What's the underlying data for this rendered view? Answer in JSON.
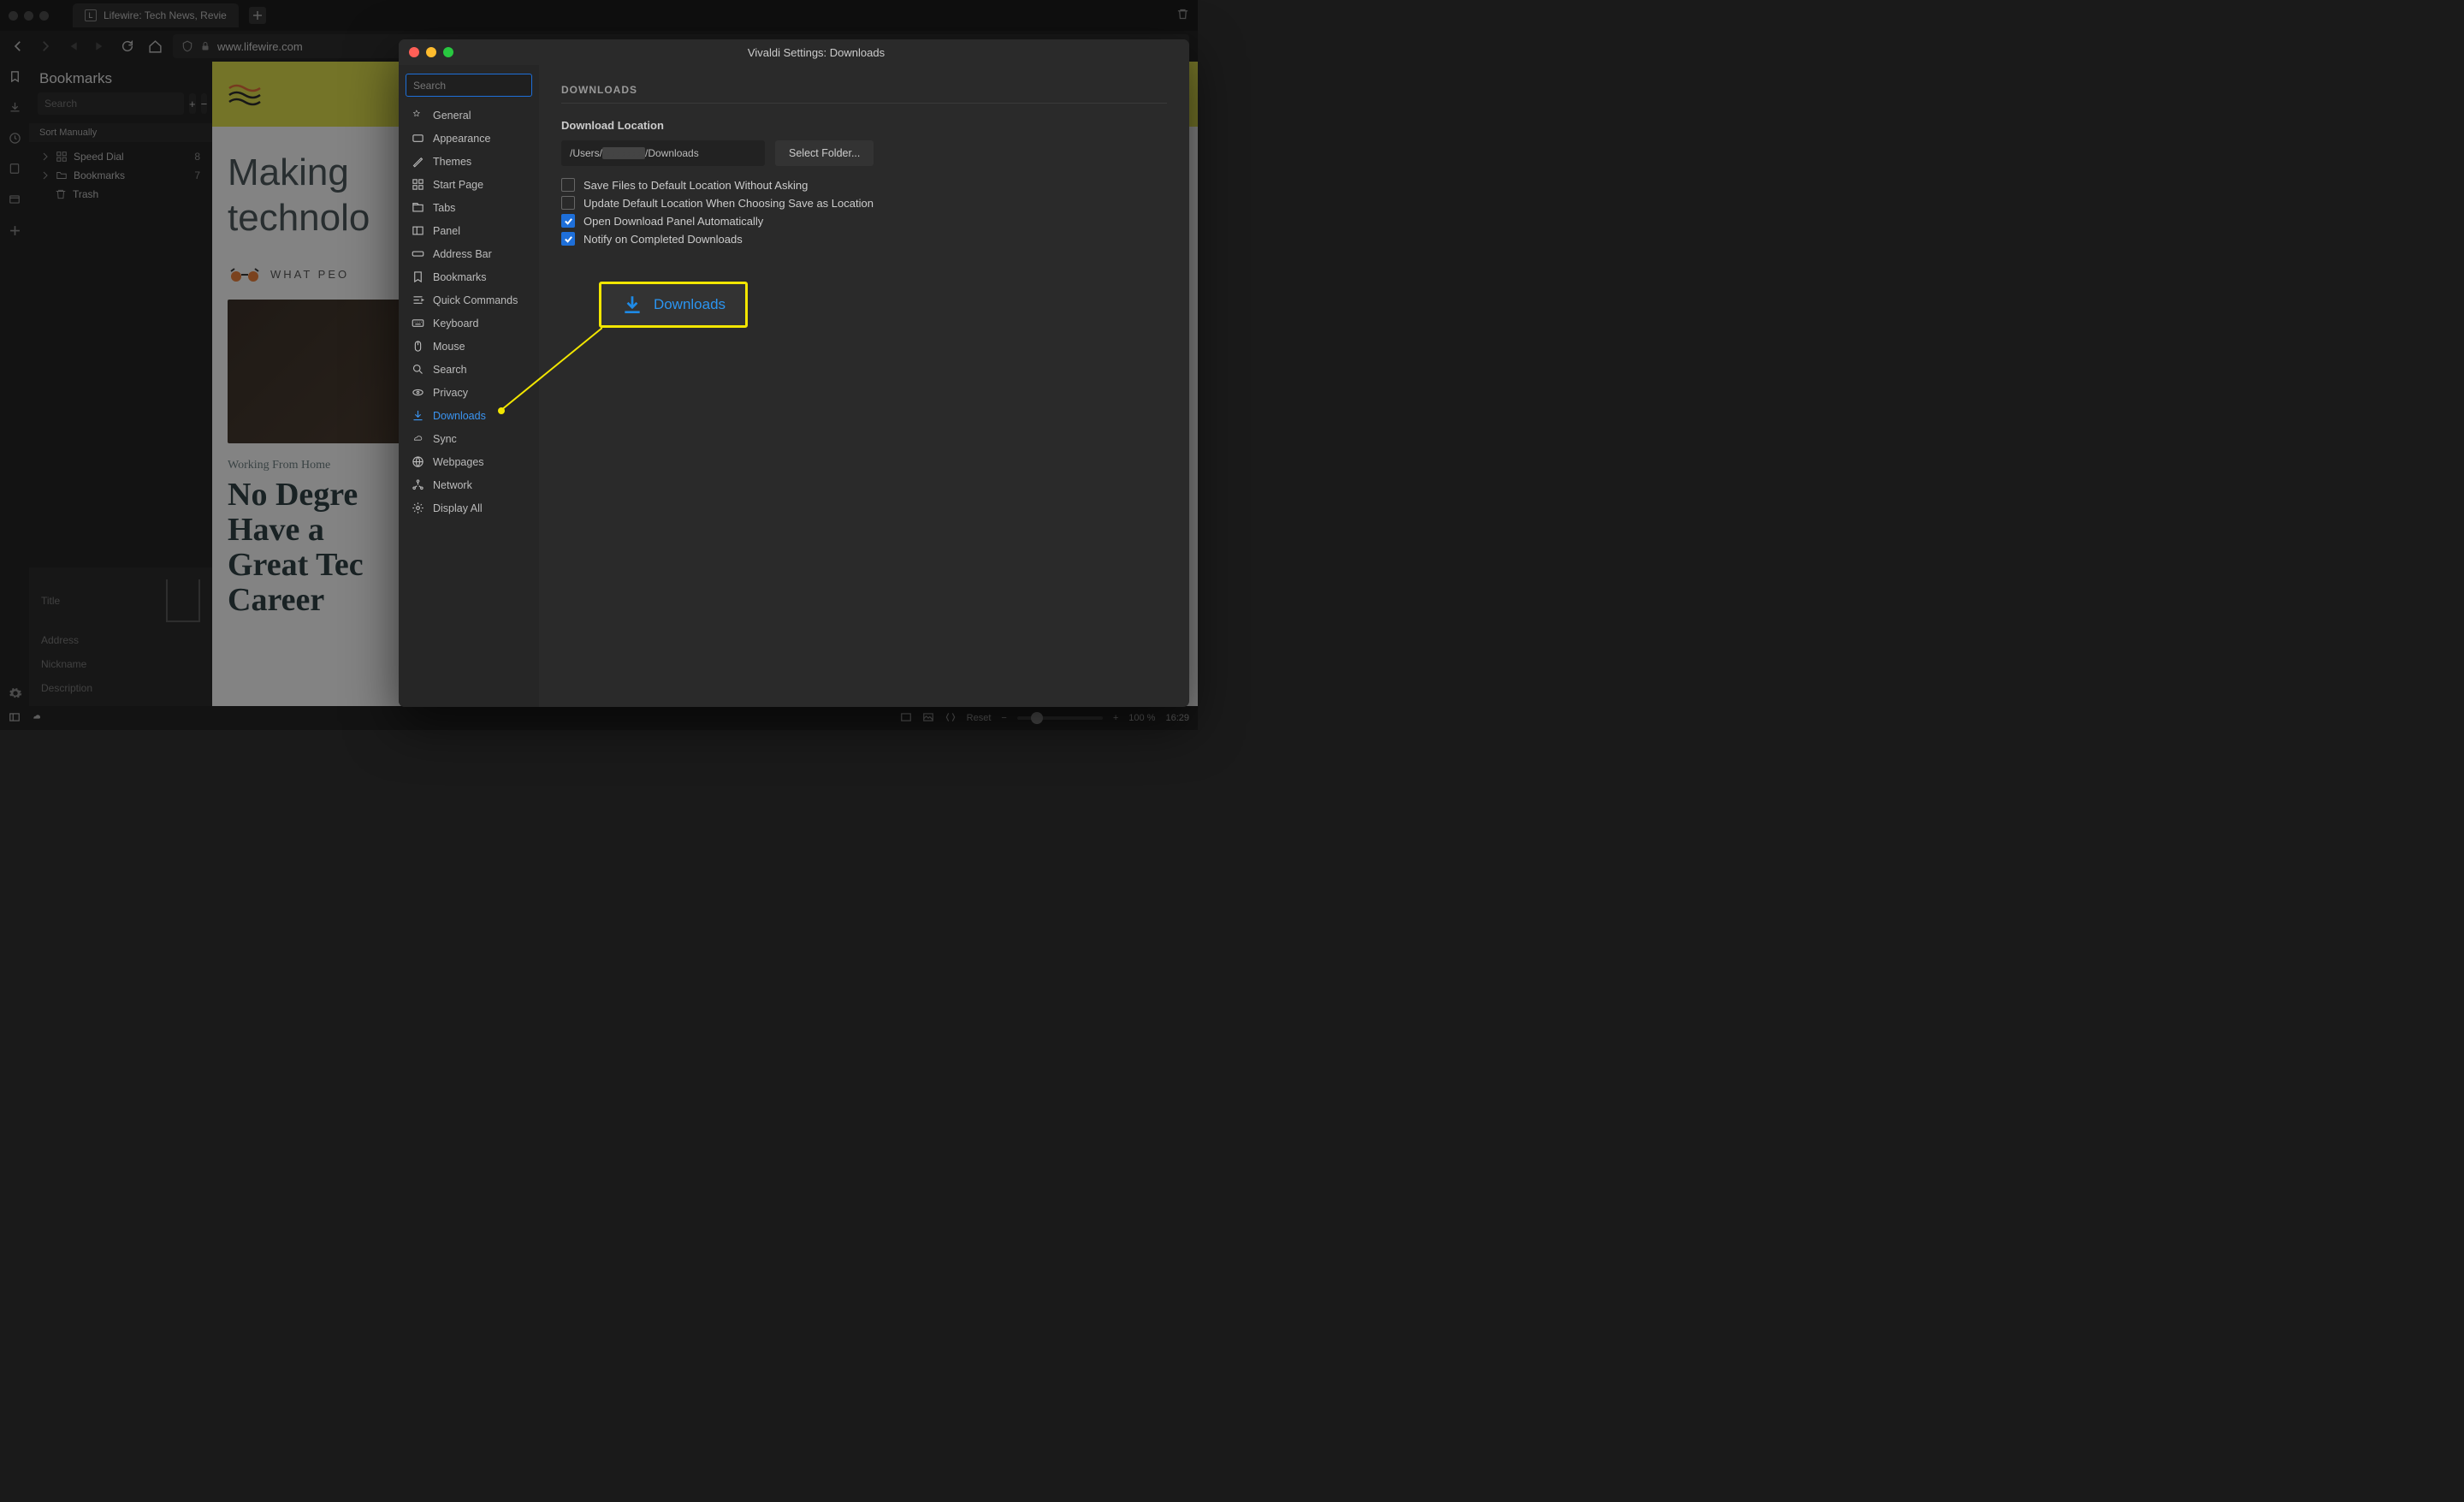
{
  "tab": {
    "title": "Lifewire: Tech News, Revie"
  },
  "address": {
    "url": "www.lifewire.com"
  },
  "bookmark_panel": {
    "title": "Bookmarks",
    "search_placeholder": "Search",
    "sort_label": "Sort Manually",
    "items": [
      {
        "label": "Speed Dial",
        "count": "8"
      },
      {
        "label": "Bookmarks",
        "count": "7"
      },
      {
        "label": "Trash",
        "count": ""
      }
    ],
    "detail": {
      "f_title": "Title",
      "f_address": "Address",
      "f_nick": "Nickname",
      "f_desc": "Description"
    }
  },
  "webpage": {
    "hero_line1": "Making",
    "hero_line2": "technolo",
    "sub": "WHAT PEO",
    "category": "Working From Home",
    "article_title": "No Degree Have a Great Tec Career"
  },
  "settings": {
    "window_title": "Vivaldi Settings: Downloads",
    "search_placeholder": "Search",
    "sidebar": [
      "General",
      "Appearance",
      "Themes",
      "Start Page",
      "Tabs",
      "Panel",
      "Address Bar",
      "Bookmarks",
      "Quick Commands",
      "Keyboard",
      "Mouse",
      "Search",
      "Privacy",
      "Downloads",
      "Sync",
      "Webpages",
      "Network",
      "Display All"
    ],
    "section_title": "DOWNLOADS",
    "location_label": "Download Location",
    "location_path_prefix": "/Users/",
    "location_path_suffix": "/Downloads",
    "select_folder": "Select Folder...",
    "checks": [
      {
        "label": "Save Files to Default Location Without Asking",
        "checked": false
      },
      {
        "label": "Update Default Location When Choosing Save as Location",
        "checked": false
      },
      {
        "label": "Open Download Panel Automatically",
        "checked": true
      },
      {
        "label": "Notify on Completed Downloads",
        "checked": true
      }
    ]
  },
  "callout": {
    "label": "Downloads"
  },
  "status": {
    "reset": "Reset",
    "zoom": "100 %",
    "time": "16:29"
  }
}
